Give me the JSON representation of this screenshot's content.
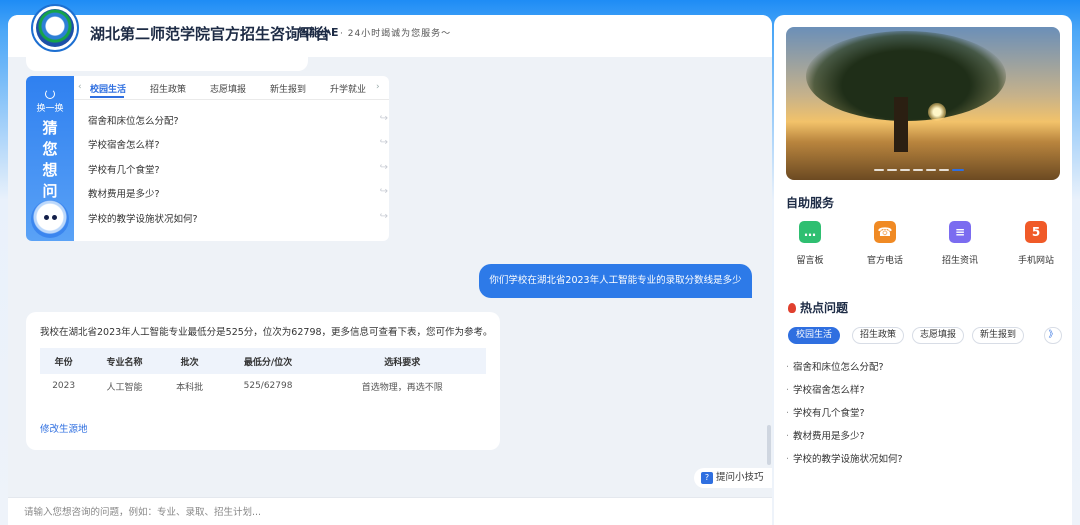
{
  "header": {
    "title": "湖北第二师范学院官方招生咨询平台",
    "brand": "智能小E",
    "slogan": "· 24小时竭诚为您服务～"
  },
  "guess": {
    "refresh_label": "换一换",
    "vertical_title": [
      "猜",
      "您",
      "想",
      "问"
    ],
    "tabs": [
      "校园生活",
      "招生政策",
      "志愿填报",
      "新生报到",
      "升学就业"
    ],
    "active_tab": "校园生活",
    "questions": [
      "宿舍和床位怎么分配?",
      "学校宿舍怎么样?",
      "学校有几个食堂?",
      "教材费用是多少?",
      "学校的教学设施状况如何?"
    ]
  },
  "chat": {
    "user_message": "你们学校在湖北省2023年人工智能专业的录取分数线是多少",
    "answer_text": "我校在湖北省2023年人工智能专业最低分是525分，位次为62798，更多信息可查看下表，您可作为参考。",
    "table": {
      "headers": [
        "年份",
        "专业名称",
        "批次",
        "最低分/位次",
        "选科要求"
      ],
      "rows": [
        [
          "2023",
          "人工智能",
          "本科批",
          "525/62798",
          "首选物理，再选不限"
        ]
      ]
    },
    "modify_link": "修改生源地"
  },
  "tips_button": "提问小技巧",
  "input": {
    "placeholder": "请输入您想咨询的问题，例如：专业、录取、招生计划..."
  },
  "right": {
    "self_service_title": "自助服务",
    "services": [
      {
        "label": "留言板",
        "icon": "message-board-icon",
        "color": "#2fbf71"
      },
      {
        "label": "官方电话",
        "icon": "phone-icon",
        "color": "#f08a24"
      },
      {
        "label": "招生资讯",
        "icon": "news-icon",
        "color": "#7b6cf0"
      },
      {
        "label": "手机网站",
        "icon": "html5-icon",
        "color": "#f05a28"
      }
    ],
    "hot_title": "热点问题",
    "hot_tabs": [
      "校园生活",
      "招生政策",
      "志愿填报",
      "新生报到"
    ],
    "hot_active": "校园生活",
    "hot_more": "》",
    "hot_questions": [
      "宿舍和床位怎么分配?",
      "学校宿舍怎么样?",
      "学校有几个食堂?",
      "教材费用是多少?",
      "学校的教学设施状况如何?"
    ]
  },
  "colors": {
    "accent": "#2f6fe0",
    "user_bubble": "#2d7ae8",
    "header_gradient_top": "#1e8cf5"
  }
}
